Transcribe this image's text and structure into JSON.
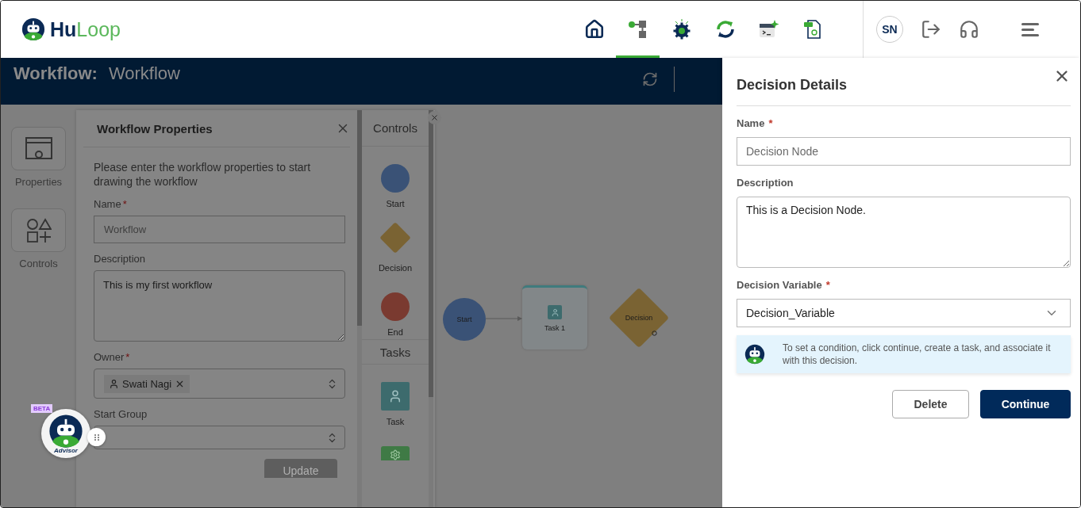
{
  "header": {
    "brand_first": "Hu",
    "brand_second": "Loop",
    "nav": [
      {
        "kind": "home",
        "selected": false
      },
      {
        "kind": "workflow",
        "selected": true
      },
      {
        "kind": "automation",
        "selected": false
      },
      {
        "kind": "sync",
        "selected": false
      },
      {
        "kind": "script",
        "selected": false
      },
      {
        "kind": "pdf",
        "selected": false
      }
    ],
    "user_initials": "SN"
  },
  "workflow_bar": {
    "label": "Workflow:",
    "name": "Workflow"
  },
  "sidebar": [
    {
      "kind": "properties",
      "label": "Properties"
    },
    {
      "kind": "shapes",
      "label": "Controls"
    }
  ],
  "properties_panel": {
    "title": "Workflow Properties",
    "intro": "Please enter the workflow properties to start drawing the workflow",
    "fields": [
      {
        "kind": "input",
        "label": "Name",
        "required_mark": "*",
        "placeholder": "Workflow"
      },
      {
        "kind": "textarea",
        "label": "Description",
        "value": "This is my first workflow"
      },
      {
        "kind": "tags",
        "label": "Owner",
        "required_mark": "*",
        "tags": [
          "Swati Nagi"
        ]
      },
      {
        "kind": "select",
        "label": "Start Group"
      }
    ],
    "button": "Update"
  },
  "palette": [
    {
      "title": "Controls",
      "items": [
        {
          "kind": "start",
          "label": "Start"
        },
        {
          "kind": "decision",
          "label": "Decision"
        },
        {
          "kind": "end",
          "label": "End"
        }
      ]
    },
    {
      "title": "Tasks",
      "items": [
        {
          "kind": "task",
          "label": "Task"
        },
        {
          "kind": "automation"
        }
      ]
    }
  ],
  "canvas": {
    "nodes": [
      {
        "kind": "start",
        "label": "Start"
      },
      {
        "kind": "task",
        "label": "Task 1"
      },
      {
        "kind": "decision",
        "label": "Decision"
      }
    ]
  },
  "advisor": {
    "badge": "BETA",
    "caption": "Advisor"
  },
  "decision_details": {
    "title": "Decision Details",
    "fields": [
      {
        "kind": "input",
        "label": "Name",
        "required_mark": "*",
        "placeholder": "Decision Node"
      },
      {
        "kind": "textarea",
        "label": "Description",
        "value": "This is a Decision Node."
      },
      {
        "kind": "select",
        "label": "Decision Variable",
        "required_mark": "*",
        "value": "Decision_Variable"
      }
    ],
    "info": "To set a condition, click continue, create a task, and associate it with this decision.",
    "buttons": [
      {
        "kind": "secondary",
        "label": "Delete"
      },
      {
        "kind": "primary",
        "label": "Continue"
      }
    ]
  }
}
